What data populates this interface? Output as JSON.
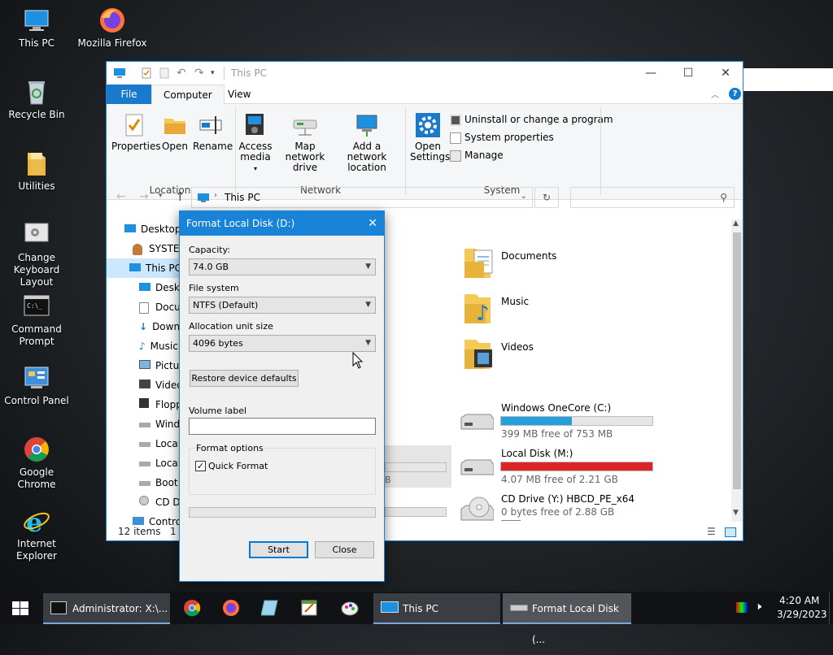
{
  "desktop": {
    "icons": [
      {
        "label": "This PC"
      },
      {
        "label": "Mozilla Firefox"
      },
      {
        "label": "Recycle Bin"
      },
      {
        "label": "Utilities"
      },
      {
        "label": "Change Keyboard Layout"
      },
      {
        "label": "Command Prompt"
      },
      {
        "label": "Control Panel"
      },
      {
        "label": "Google Chrome"
      },
      {
        "label": "Internet Explorer"
      }
    ]
  },
  "explorer": {
    "title": "This PC",
    "tabs": {
      "file": "File",
      "computer": "Computer",
      "view": "View"
    },
    "ribbon": {
      "properties": "Properties",
      "open": "Open",
      "rename": "Rename",
      "location_group": "Location",
      "access_media": "Access media",
      "map_network_drive": "Map network drive",
      "add_network_location": "Add a network location",
      "network_group": "Network",
      "open_settings": "Open Settings",
      "uninstall": "Uninstall or change a program",
      "system_properties": "System properties",
      "manage": "Manage",
      "system_group": "System"
    },
    "address": "This PC",
    "search_placeholder": "",
    "nav_items": [
      "Desktop",
      "SYSTEM",
      "This PC",
      "Desktop",
      "Documents",
      "Downloads",
      "Music",
      "Pictures",
      "Videos",
      "Floppy",
      "Windows",
      "Local",
      "Local",
      "Boot",
      "CD Drive",
      "Control"
    ],
    "folders": [
      {
        "name": "Documents"
      },
      {
        "name": "Music"
      },
      {
        "name": "Videos"
      }
    ],
    "drives": [
      {
        "name": "Windows OneCore (C:)",
        "free": "399 MB free of 753 MB",
        "used_fraction": 0.47,
        "color": "#26a0da"
      },
      {
        "name": "Local Disk (M:)",
        "free": "4.07 MB free of 2.21 GB",
        "used_fraction": 0.998,
        "color": "#da2626"
      },
      {
        "name": "CD Drive (Y:) HBCD_PE_x64",
        "free": "0 bytes free of 2.88 GB"
      }
    ],
    "partial_gb": "B",
    "status_items": "12 items",
    "status_selected": "1"
  },
  "dialog": {
    "title": "Format Local Disk (D:)",
    "capacity_label": "Capacity:",
    "capacity_value": "74.0 GB",
    "fs_label": "File system",
    "fs_value": "NTFS (Default)",
    "alloc_label": "Allocation unit size",
    "alloc_value": "4096 bytes",
    "restore_label": "Restore device defaults",
    "volume_label": "Volume label",
    "volume_value": "",
    "format_options": "Format options",
    "quick_format": "Quick Format",
    "quick_checked": true,
    "progress": 0,
    "start": "Start",
    "close": "Close"
  },
  "taskbar": {
    "windows": [
      {
        "label": "Administrator: X:\\..."
      },
      {
        "label": "This PC"
      },
      {
        "label": "Format Local Disk (..."
      }
    ],
    "time": "4:20 AM",
    "date": "3/29/2023"
  }
}
